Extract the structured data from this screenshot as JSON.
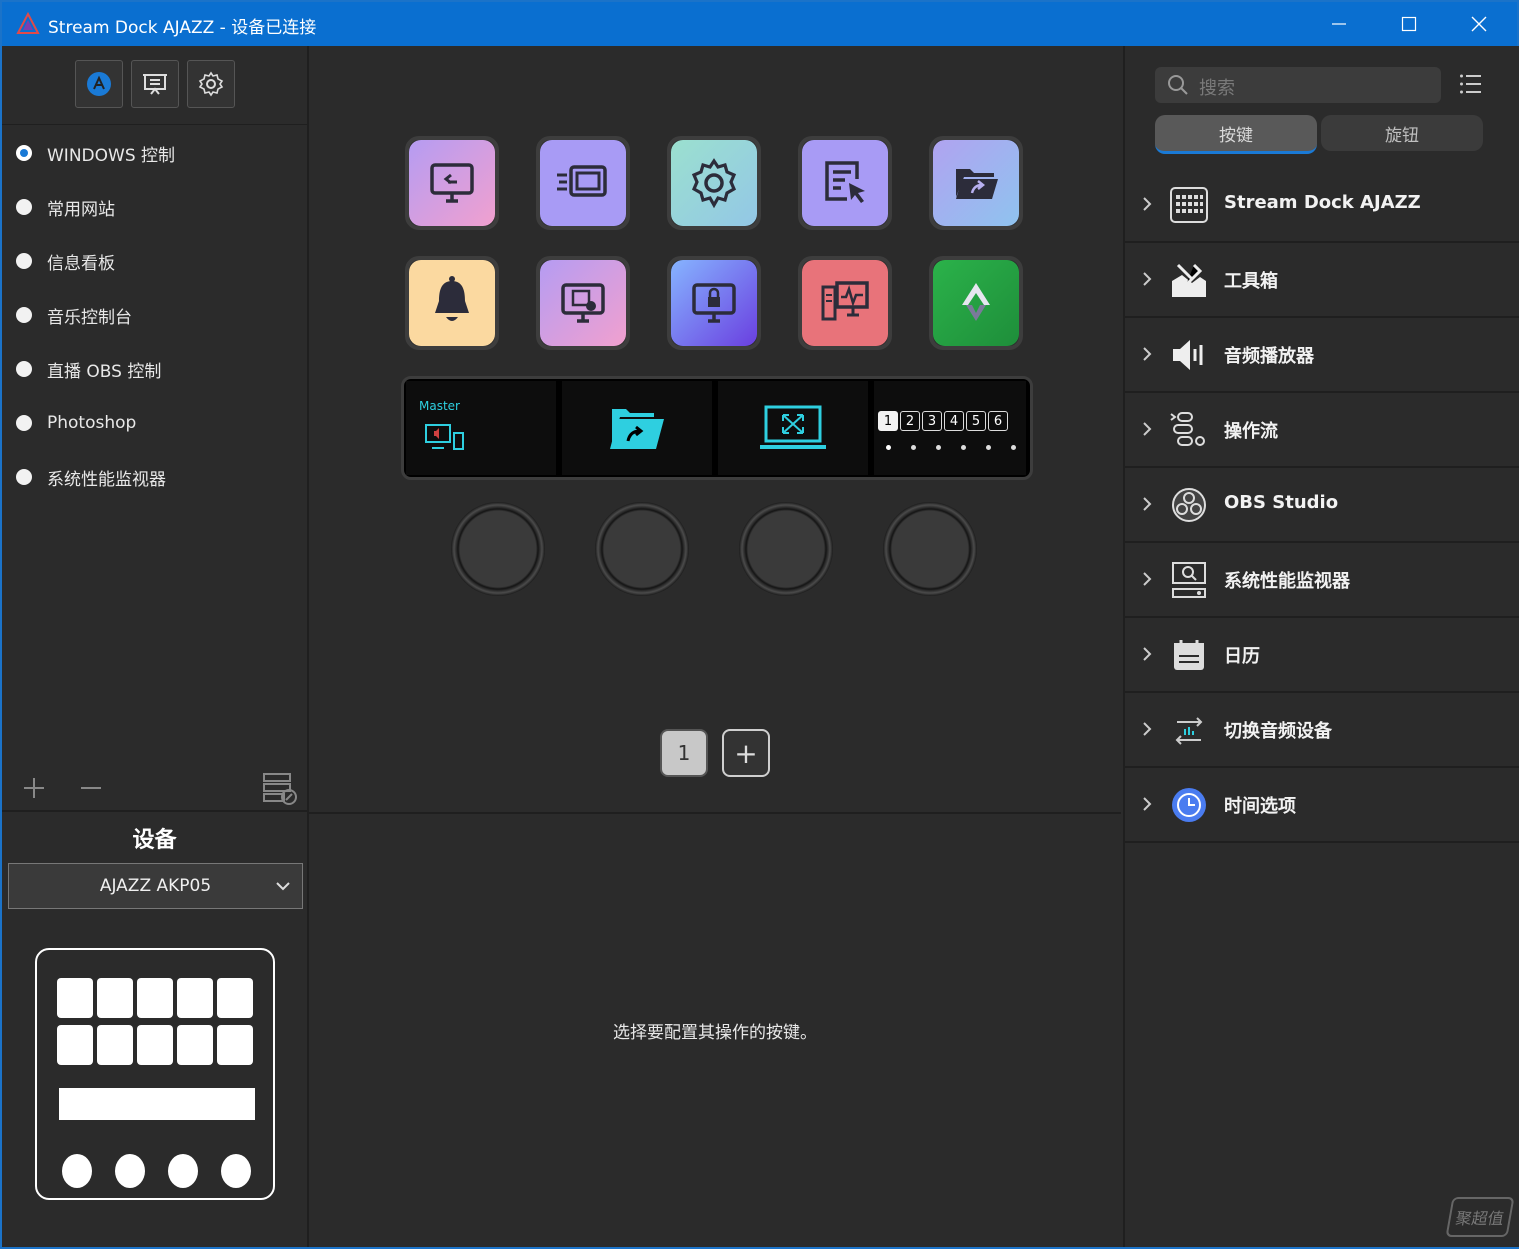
{
  "window": {
    "title": "Stream Dock AJAZZ - 设备已连接"
  },
  "profiles": [
    {
      "label": "WINDOWS 控制",
      "selected": true
    },
    {
      "label": "常用网站",
      "selected": false
    },
    {
      "label": "信息看板",
      "selected": false
    },
    {
      "label": "音乐控制台",
      "selected": false
    },
    {
      "label": "直播 OBS 控制",
      "selected": false
    },
    {
      "label": "Photoshop",
      "selected": false
    },
    {
      "label": "系统性能监视器",
      "selected": false
    }
  ],
  "device": {
    "section_title": "设备",
    "selected": "AJAZZ AKP05"
  },
  "strip": {
    "master_label": "Master",
    "page_numbers": [
      "1",
      "2",
      "3",
      "4",
      "5",
      "6"
    ]
  },
  "pager": {
    "current": "1",
    "add": "+"
  },
  "hint": "选择要配置其操作的按键。",
  "right": {
    "search_placeholder": "搜索",
    "tabs": [
      {
        "label": "按键",
        "active": true
      },
      {
        "label": "旋钮",
        "active": false
      }
    ],
    "plugins": [
      {
        "name": "Stream Dock AJAZZ",
        "icon": "keypad-icon"
      },
      {
        "name": "工具箱",
        "icon": "toolbox-icon"
      },
      {
        "name": "音频播放器",
        "icon": "speaker-icon"
      },
      {
        "name": "操作流",
        "icon": "flow-icon"
      },
      {
        "name": "OBS Studio",
        "icon": "obs-icon"
      },
      {
        "name": "系统性能监视器",
        "icon": "monitor-icon"
      },
      {
        "name": "日历",
        "icon": "calendar-icon"
      },
      {
        "name": "切换音频设备",
        "icon": "audio-switch-icon"
      },
      {
        "name": "时间选项",
        "icon": "clock-icon"
      }
    ]
  },
  "watermark": "聚超值",
  "colors": {
    "titlebar": "#0a6fd0",
    "accent": "#1a7ad6",
    "panel": "#2b2b2b"
  }
}
